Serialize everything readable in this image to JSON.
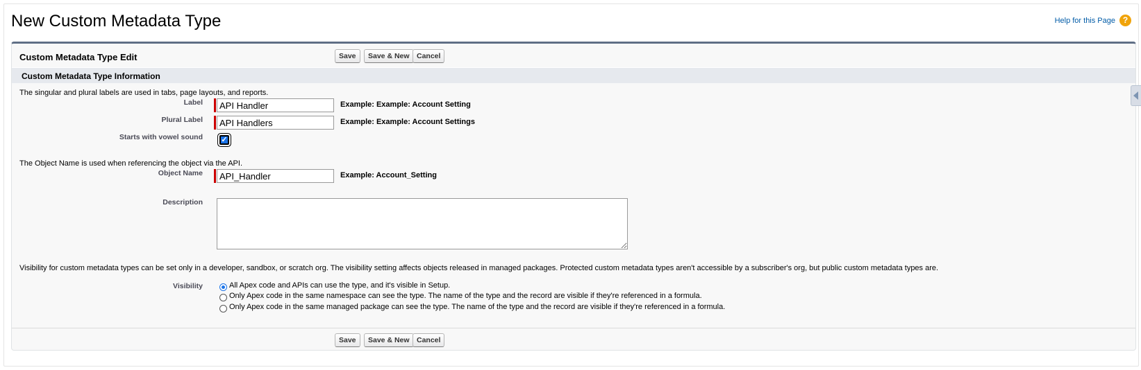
{
  "page": {
    "title": "New Custom Metadata Type",
    "help_link": "Help for this Page",
    "help_icon": "question-icon"
  },
  "edit_block": {
    "title": "Custom Metadata Type Edit",
    "buttons": {
      "save": "Save",
      "save_new": "Save & New",
      "cancel": "Cancel"
    }
  },
  "section": {
    "title": "Custom Metadata Type Information",
    "labels_help": "The singular and plural labels are used in tabs, page layouts, and reports.",
    "object_help": "The Object Name is used when referencing the object via the API.",
    "visibility_help": "Visibility for custom metadata types can be set only in a developer, sandbox, or scratch org. The visibility setting affects objects released in managed packages. Protected custom metadata types aren't accessible by a subscriber's org, but public custom metadata types are."
  },
  "fields": {
    "label": {
      "name": "Label",
      "value": "API Handler",
      "example": "Example:  Example: Account Setting"
    },
    "plural_label": {
      "name": "Plural Label",
      "value": "API Handlers",
      "example": "Example:  Example: Account Settings"
    },
    "vowel": {
      "name": "Starts with vowel sound",
      "checked": true
    },
    "object_name": {
      "name": "Object Name",
      "value": "API_Handler",
      "example": "Example:  Account_Setting"
    },
    "description": {
      "name": "Description",
      "value": ""
    },
    "visibility": {
      "name": "Visibility",
      "options": [
        "All Apex code and APIs can use the type, and it's visible in Setup.",
        "Only Apex code in the same namespace can see the type. The name of the type and the record are visible if they're referenced in a formula.",
        "Only Apex code in the same managed package can see the type. The name of the type and the record are visible if they're referenced in a formula."
      ],
      "selected": 0
    }
  },
  "colors": {
    "panel_border": "#5f6e85",
    "section_bg": "#e6e9ee",
    "required": "#cc0000",
    "link": "#015ba7",
    "help_icon": "#f0a30a"
  }
}
